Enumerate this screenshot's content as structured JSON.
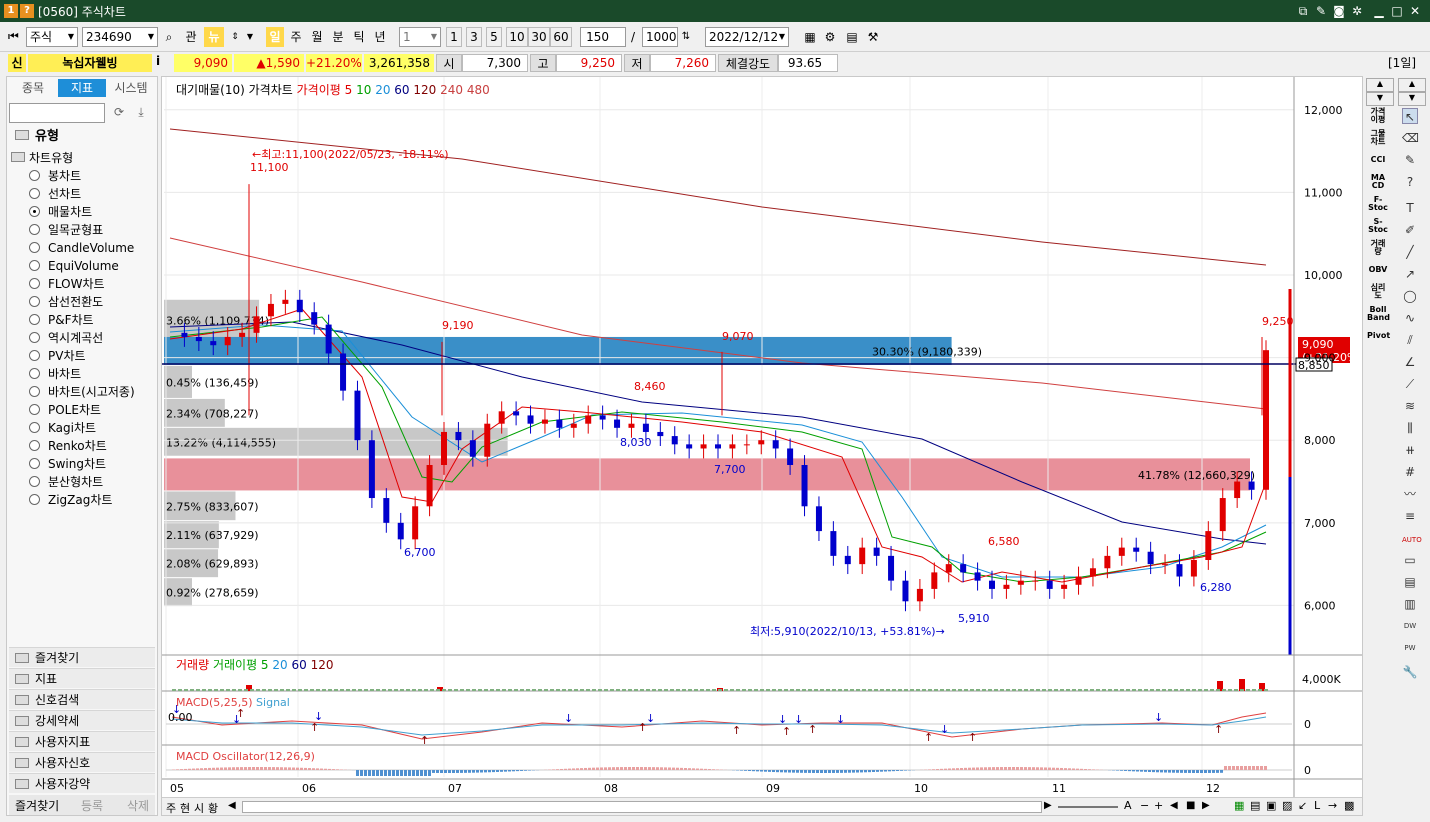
{
  "window": {
    "badge1": "1",
    "badge2": "?",
    "title": "[0560] 주식차트"
  },
  "toolbar": {
    "market": "주식",
    "code": "234690",
    "btn_gwan": "관",
    "btn_new": "뉴",
    "periods": [
      "일",
      "주",
      "월",
      "분",
      "틱",
      "년"
    ],
    "unit_value": "1",
    "quick": [
      "1",
      "3",
      "5",
      "10",
      "30",
      "60"
    ],
    "count": "150",
    "slash": "/",
    "total": "1000",
    "date": "2022/12/12"
  },
  "pricebar": {
    "sin": "신",
    "name": "녹십자웰빙",
    "info": "i",
    "price": "9,090",
    "change": "▲1,590",
    "rate": "+21.20%",
    "volume": "3,261,358",
    "open_label": "시",
    "open": "7,300",
    "high_label": "고",
    "high": "9,250",
    "low_label": "저",
    "low": "7,260",
    "strength_label": "체결강도",
    "strength": "93.65",
    "period": "[1일]"
  },
  "sidebar": {
    "tabs": [
      "종목",
      "지표",
      "시스템"
    ],
    "group": "유형",
    "subgroup": "차트유형",
    "types": [
      "봉차트",
      "선차트",
      "매물차트",
      "일목균형표",
      "CandleVolume",
      "EquiVolume",
      "FLOW차트",
      "삼선전환도",
      "P&F차트",
      "역시계곡선",
      "PV차트",
      "바차트",
      "바차트(시고저종)",
      "POLE차트",
      "Kagi차트",
      "Renko차트",
      "Swing차트",
      "분산형차트",
      "ZigZag차트"
    ],
    "selected": "매물차트",
    "accordion": [
      "즐겨찾기",
      "지표",
      "신호검색",
      "강세약세",
      "사용자지표",
      "사용자신호",
      "사용자강약"
    ],
    "bottom": [
      "즐겨찾기",
      "등록",
      "삭제"
    ]
  },
  "legend": {
    "main": [
      "대기매물(10)",
      "가격차트",
      "가격이평 5",
      "10",
      "20",
      "60",
      "120",
      "240",
      "480"
    ],
    "volume": [
      "거래량",
      "거래이평 5",
      "20",
      "60",
      "120"
    ],
    "macd": [
      "MACD(5,25,5)",
      "Signal"
    ],
    "osc": [
      "MACD Oscillator(12,26,9)"
    ]
  },
  "colors": {
    "up": "#e00000",
    "down": "#0000cc",
    "ma5": "#e00000",
    "ma10": "#00a000",
    "ma20": "#1a8fd8",
    "ma60": "#000080",
    "ma120": "#800000",
    "ma240": "#c84040",
    "vp_blue": "#3a8fc8",
    "vp_pink": "#e8909a",
    "vp_gray": "#c8c8c8"
  },
  "chart_data": {
    "type": "candlestick",
    "price_axis": [
      "12,000",
      "11,000",
      "10,000",
      "9,000",
      "8,000",
      "7,000",
      "6,000"
    ],
    "ylim": [
      5400,
      12300
    ],
    "x_months": [
      "05",
      "06",
      "07",
      "08",
      "09",
      "10",
      "11",
      "12"
    ],
    "annotations": {
      "high": "←최고:11,100(2022/05/23, -18.11%)",
      "low": "최저:5,910(2022/10/13, +53.81%)→",
      "labels": [
        "11,100",
        "9,190",
        "8,460",
        "9,070",
        "8,030",
        "7,700",
        "6,700",
        "6,580",
        "5,910",
        "6,280",
        "9,250"
      ]
    },
    "volume_profile": [
      {
        "label": "3.66% (1,109,734)",
        "from": 9200,
        "to": 9700
      },
      {
        "label": "30.30% (9,180,339)",
        "from": 8900,
        "to": 9250
      },
      {
        "label": "0.45% (136,459)",
        "from": 8500,
        "to": 8900
      },
      {
        "label": "2.34% (708,227)",
        "from": 8150,
        "to": 8500
      },
      {
        "label": "13.22% (4,114,555)",
        "from": 7800,
        "to": 8150
      },
      {
        "label": "41.78% (12,660,329)",
        "from": 7380,
        "to": 7780
      },
      {
        "label": "2.75% (833,607)",
        "from": 7020,
        "to": 7380
      },
      {
        "label": "2.11% (637,929)",
        "from": 6680,
        "to": 7020
      },
      {
        "label": "2.08% (629,893)",
        "from": 6330,
        "to": 6680
      },
      {
        "label": "0.92% (278,659)",
        "from": 5980,
        "to": 6330
      }
    ],
    "current_price": "9,090",
    "current_rate": "(+21.20%)",
    "cursor_price": "8,850",
    "volume_axis": "4,000K",
    "macd_axis": "0",
    "macd_label": "0.00",
    "osc_axis": "0"
  },
  "bottombar": {
    "buttons": [
      "주",
      "현",
      "시",
      "황"
    ]
  },
  "rightbar": {
    "labels": [
      "가격 이평",
      "그물 차트",
      "CCI",
      "MA CD",
      "F- Stoc",
      "S- Stoc",
      "거래 량",
      "OBV",
      "심리 도",
      "Boll Band",
      "Pivot"
    ]
  }
}
